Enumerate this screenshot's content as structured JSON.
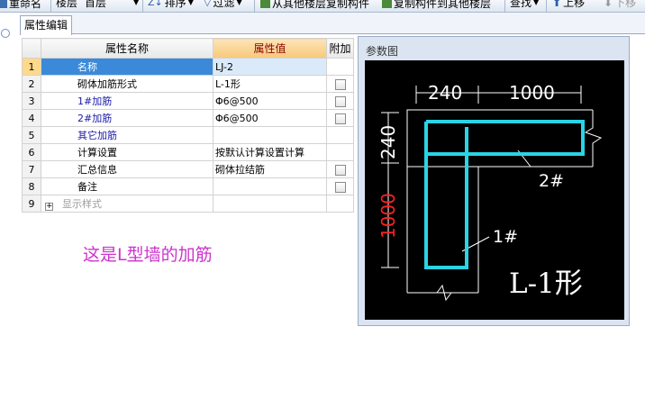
{
  "toolbar": {
    "rename": "重命名",
    "floor_label": "楼层",
    "floor_value": "首层",
    "sort": "排序",
    "filter": "过滤",
    "copy_from": "从其他楼层复制构件",
    "copy_to": "复制构件到其他楼层",
    "find": "查找",
    "move_up": "上移",
    "move_down": "下移"
  },
  "tab": {
    "label": "属性编辑"
  },
  "grid": {
    "headers": {
      "name": "属性名称",
      "value": "属性值",
      "extra": "附加"
    },
    "rows": [
      {
        "num": "1",
        "name": "名称",
        "value": "LJ-2",
        "checkbox": false
      },
      {
        "num": "2",
        "name": "砌体加筋形式",
        "value": "L-1形",
        "checkbox": true
      },
      {
        "num": "3",
        "name": "1#加筋",
        "value": "Φ6@500",
        "checkbox": true
      },
      {
        "num": "4",
        "name": "2#加筋",
        "value": "Φ6@500",
        "checkbox": true
      },
      {
        "num": "5",
        "name": "其它加筋",
        "value": "",
        "checkbox": false
      },
      {
        "num": "6",
        "name": "计算设置",
        "value": "按默认计算设置计算",
        "checkbox": false
      },
      {
        "num": "7",
        "name": "汇总信息",
        "value": "砌体拉结筋",
        "checkbox": true
      },
      {
        "num": "8",
        "name": "备注",
        "value": "",
        "checkbox": true
      },
      {
        "num": "9",
        "name": "显示样式",
        "value": "",
        "checkbox": false
      }
    ]
  },
  "annotation": "这是L型墙的加筋",
  "panel": {
    "title": "参数图",
    "dim_top_left": "240",
    "dim_top_right": "1000",
    "dim_left_top": "240",
    "dim_left_bottom": "1000",
    "label_bar2": "2#",
    "label_bar1": "1#",
    "shape_label": "L-1形"
  },
  "colors": {
    "canvas_bg": "#000000",
    "rebar": "#2ad4e6",
    "dim_white": "#ffffff",
    "dim_red": "#ff2020",
    "annotation": "#cc33cc"
  }
}
